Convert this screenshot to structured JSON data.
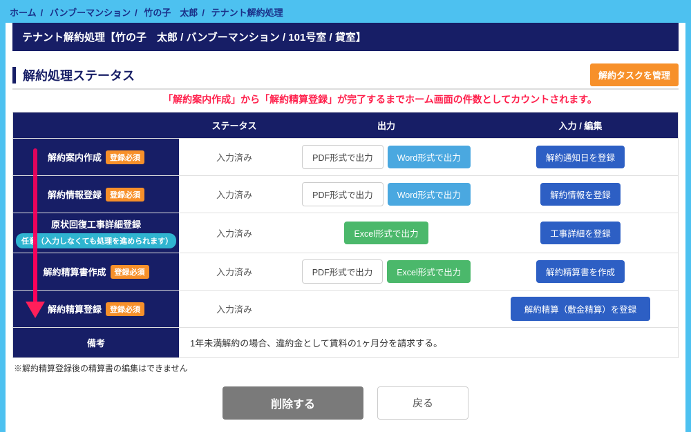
{
  "breadcrumb": {
    "items": [
      "ホーム",
      "バンブーマンション",
      "竹の子　太郎",
      "テナント解約処理"
    ]
  },
  "title": "テナント解約処理【竹の子　太郎 / バンブーマンション / 101号室 / 貸室】",
  "section_title": "解約処理ステータス",
  "manage_btn": "解約タスクを管理",
  "red_note": "「解約案内作成」から「解約精算登録」が完了するまでホーム画面の件数としてカウントされます。",
  "thead": {
    "c1": "",
    "c2": "ステータス",
    "c3": "出力",
    "c4": "入力 / 編集"
  },
  "badge_required": "登録必須",
  "badge_optional": "任意（入力しなくても処理を進められます）",
  "rows": [
    {
      "name": "解約案内作成",
      "required": true,
      "status": "入力済み",
      "out": [
        {
          "label": "PDF形式で出力",
          "style": "outline"
        },
        {
          "label": "Word形式で出力",
          "style": "blue"
        }
      ],
      "edit": {
        "label": "解約通知日を登録",
        "style": "navy"
      }
    },
    {
      "name": "解約情報登録",
      "required": true,
      "status": "入力済み",
      "out": [
        {
          "label": "PDF形式で出力",
          "style": "outline"
        },
        {
          "label": "Word形式で出力",
          "style": "blue"
        }
      ],
      "edit": {
        "label": "解約情報を登録",
        "style": "navy"
      }
    },
    {
      "name": "原状回復工事詳細登録",
      "required": false,
      "status": "入力済み",
      "out": [
        {
          "label": "Excel形式で出力",
          "style": "green"
        }
      ],
      "edit": {
        "label": "工事詳細を登録",
        "style": "navy"
      }
    },
    {
      "name": "解約精算書作成",
      "required": true,
      "status": "入力済み",
      "out": [
        {
          "label": "PDF形式で出力",
          "style": "outline"
        },
        {
          "label": "Excel形式で出力",
          "style": "green"
        }
      ],
      "edit": {
        "label": "解約精算書を作成",
        "style": "navy"
      }
    },
    {
      "name": "解約精算登録",
      "required": true,
      "status": "入力済み",
      "out": [],
      "edit": {
        "label": "解約精算（敷金精算）を登録",
        "style": "navy-wide"
      }
    }
  ],
  "remark": {
    "label": "備考",
    "value": "1年未満解約の場合、違約金として賃料の1ヶ月分を請求する。"
  },
  "footnote": "※解約精算登録後の精算書の編集はできません",
  "actions": {
    "delete": "削除する",
    "back": "戻る"
  }
}
